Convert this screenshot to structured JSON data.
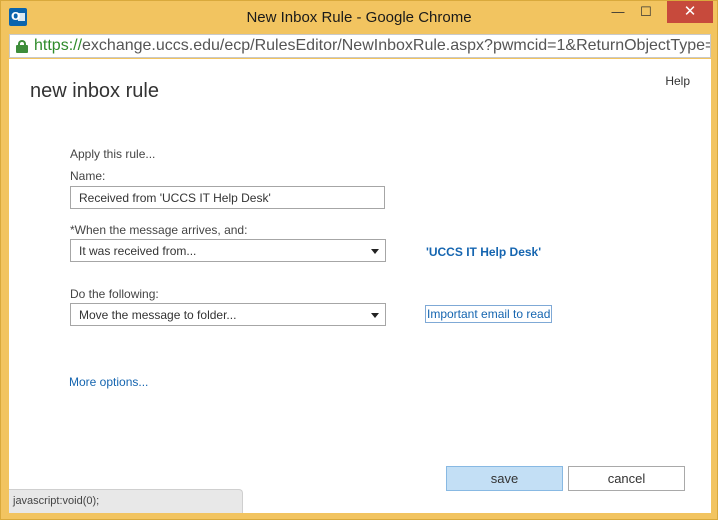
{
  "window": {
    "title": "New Inbox Rule - Google Chrome",
    "minimize_glyph": "—",
    "maximize_glyph": "☐",
    "close_glyph": "✕"
  },
  "address_bar": {
    "scheme": "https://",
    "url_rest": "exchange.uccs.edu/ecp/RulesEditor/NewInboxRule.aspx?pwmcid=1&ReturnObjectType="
  },
  "page": {
    "help": "Help",
    "title": "new inbox rule"
  },
  "form": {
    "apply_label": "Apply this rule...",
    "name_label": "Name:",
    "name_value": "Received from 'UCCS IT Help Desk'",
    "when_label": "*When the message arrives, and:",
    "when_selected": "It was received from...",
    "when_value_link": "'UCCS IT Help Desk'",
    "do_label": "Do the following:",
    "do_selected": "Move the message to folder...",
    "do_value_link": "Important email to read",
    "more_options": "More options..."
  },
  "buttons": {
    "save": "save",
    "cancel": "cancel"
  },
  "status_bar": {
    "text": "javascript:void(0);"
  },
  "icons": {
    "app": "outlook-icon",
    "lock": "lock-icon",
    "dropdown": "chevron-down-icon"
  },
  "colors": {
    "window_frame": "#f2c460",
    "link": "#1565b0",
    "save_button": "#c3dff5",
    "secure_green": "#2e8b2a"
  }
}
